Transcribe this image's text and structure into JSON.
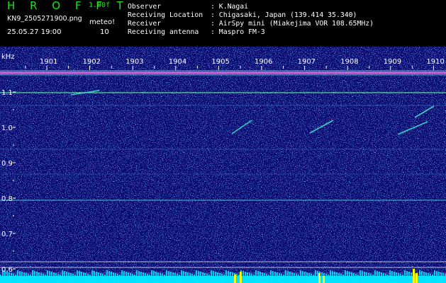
{
  "app": {
    "title": "H R O F F T",
    "version": "1.00f"
  },
  "file": {
    "name": "KN9_2505271900.png",
    "datetime": "25.05.27 19:00"
  },
  "meteo": {
    "label": "meteo!",
    "count": "10"
  },
  "info": [
    {
      "label": "Observer",
      "value": ": K.Nagai"
    },
    {
      "label": "Receiving Location",
      "value": ": Chigasaki, Japan (139.414 35.340)"
    },
    {
      "label": "Receiver",
      "value": ": AirSpy mini (Miakejima VOR 108.65MHz)"
    },
    {
      "label": "Receiving antenna",
      "value": ": Maspro FM-3"
    }
  ],
  "axis": {
    "unit": "kHz",
    "y_ticks": [
      "1.1",
      "1.0",
      "0.9",
      "0.8",
      "0.7",
      "0.6"
    ],
    "x_ticks": [
      "1901",
      "1902",
      "1903",
      "1904",
      "1905",
      "1906",
      "1907",
      "1908",
      "1909",
      "1910"
    ]
  },
  "colors": {
    "background": "#000000",
    "waterfall": "#0a0a6e",
    "logo": "#19e319",
    "trace": "#3fe0d0",
    "noise_floor": "#00e5ff",
    "spike": "#ffff00"
  }
}
